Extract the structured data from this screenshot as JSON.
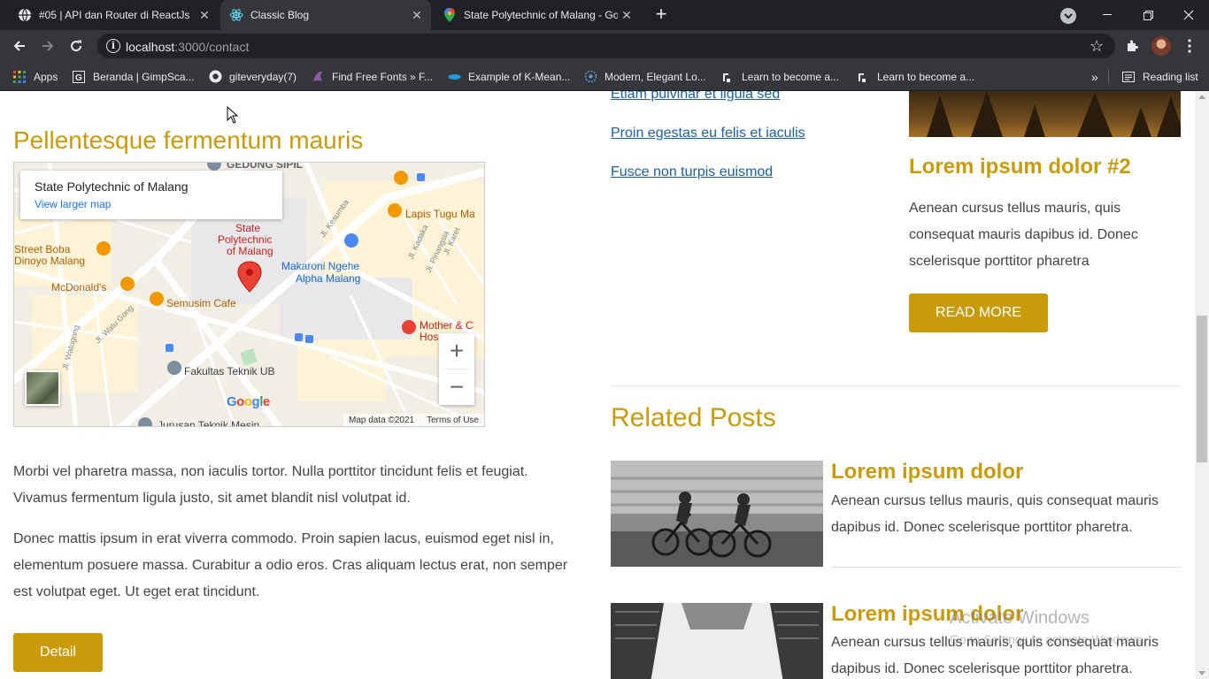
{
  "browser": {
    "tabs": [
      {
        "title": "#05 | API dan Router di ReactJs",
        "icon": "globe-icon"
      },
      {
        "title": "Classic Blog",
        "icon": "react-icon",
        "active": true
      },
      {
        "title": "State Polytechnic of Malang - Go",
        "icon": "maps-pin-icon"
      }
    ],
    "url_host": "localhost",
    "url_path": ":3000/contact",
    "bookmarks": [
      {
        "label": "Apps",
        "icon": "apps-grid-icon"
      },
      {
        "label": "Beranda | GimpSca...",
        "icon": "gimp-icon"
      },
      {
        "label": "giteveryday(7)",
        "icon": "github-icon"
      },
      {
        "label": "Find Free Fonts » F...",
        "icon": "fonts-icon"
      },
      {
        "label": "Example of K-Mean...",
        "icon": "kmean-icon"
      },
      {
        "label": "Modern, Elegant Lo...",
        "icon": "logo-icon"
      },
      {
        "label": "Learn to become a...",
        "icon": "roadmap-icon"
      },
      {
        "label": "Learn to become a...",
        "icon": "roadmap-icon"
      }
    ],
    "reading_list": "Reading list"
  },
  "post": {
    "title": "Pellentesque fermentum mauris",
    "paragraph_1": "Morbi vel pharetra massa, non iaculis tortor. Nulla porttitor tincidunt felis et feugiat. Vivamus fermentum ligula justo, sit amet blandit nisl volutpat id.",
    "paragraph_2": "Donec mattis ipsum in erat viverra commodo. Proin sapien lacus, euismod eget nisl in, elementum posuere massa. Curabitur a odio eros. Cras aliquam lectus erat, non semper est volutpat eget. Ut eget erat tincidunt.",
    "detail_button": "Detail"
  },
  "map": {
    "place_name": "State Polytechnic of Malang",
    "view_larger": "View larger map",
    "labels": {
      "gedung": "GEDUNG SIPIL",
      "polinema": "State Polytechnic of Malang",
      "makaroni": "Makaroni Ngehe Alpha Malang",
      "lapis": "Lapis Tugu Ma",
      "street_boba": "Street Boba Dinoyo Malang",
      "mcd": "McDonald's",
      "semusim": "Semusim Cafe",
      "mother": "Mother & C Hos",
      "fakultas": "Fakultas Teknik UB",
      "jurusan": "Jurusan Teknik Mesin",
      "jl_kesumba": "Jl. Kesumba",
      "jl_kadaka": "Jl. Kadaka",
      "jl_pinangsia": "Jl. Pinangsia",
      "jl_karet": "Jl. Karet",
      "jl_watugong": "Jl. Watugong",
      "jl_watu_gong": "Jl. Watu Gong"
    },
    "google": "Google",
    "map_data": "Map data ©2021",
    "terms": "Terms of Use"
  },
  "sidebar_links": [
    "Etiam pulvinar et ligula sed",
    "Proin egestas eu felis et iaculis",
    "Fusce non turpis euismod"
  ],
  "card": {
    "title": "Lorem ipsum dolor #2",
    "text": "Aenean cursus tellus mauris, quis consequat mauris dapibus id. Donec scelerisque porttitor pharetra",
    "button": "READ MORE"
  },
  "related": {
    "heading": "Related Posts",
    "items": [
      {
        "title": "Lorem ipsum dolor",
        "text": "Aenean cursus tellus mauris, quis consequat mauris dapibus id. Donec scelerisque porttitor pharetra."
      },
      {
        "title": "Lorem ipsum dolor",
        "text": "Aenean cursus tellus mauris, quis consequat mauris dapibus id. Donec scelerisque porttitor pharetra."
      }
    ]
  },
  "watermark": {
    "line1": "Activate Windows",
    "line2": "Go to Settings to activate Windows."
  },
  "colors": {
    "accent": "#c99a0a",
    "link": "#1a5fa8",
    "chrome_dark": "#202124",
    "chrome_mid": "#35363a"
  }
}
